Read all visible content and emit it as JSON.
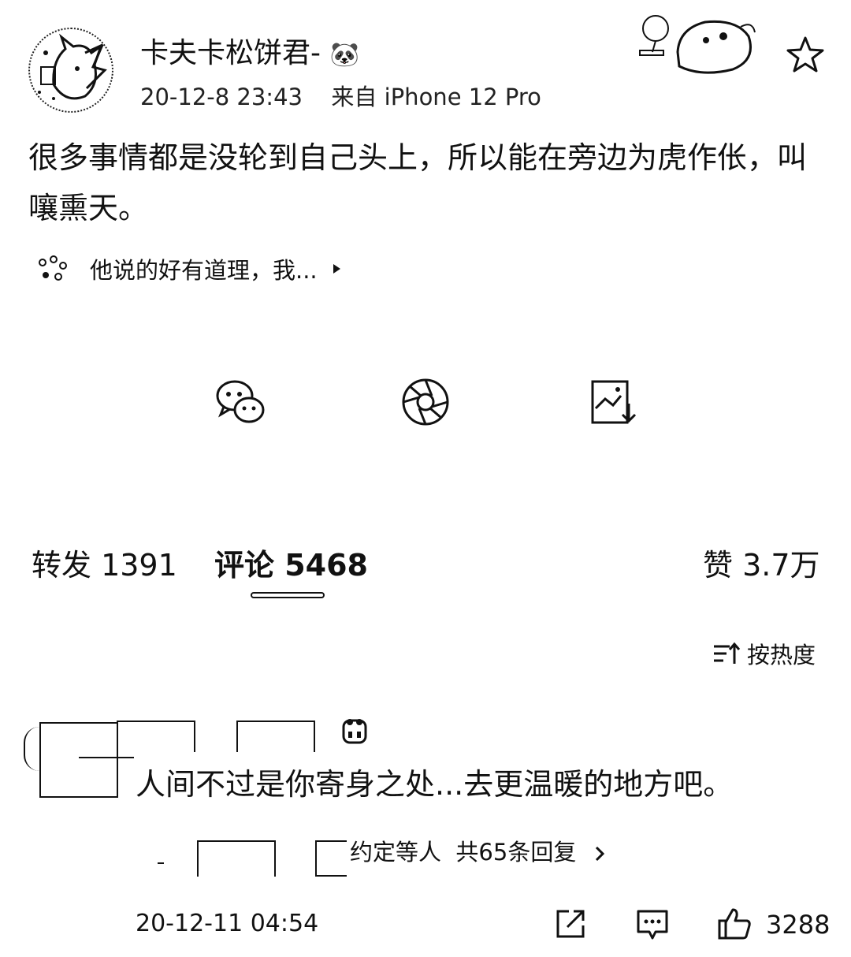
{
  "post": {
    "username": "卡夫卡松饼君-",
    "username_emoji": "🐼",
    "timestamp": "20-12-8 23:43",
    "source": "来自 iPhone 12 Pro",
    "content": "很多事情都是没轮到自己头上，所以能在旁边为虎作伥，叫嚷熏天。",
    "topic_text": "他说的好有道理，我...",
    "icons": {
      "favorite": "star-icon",
      "topic": "sparkle-icon",
      "share": [
        "wechat-icon",
        "moments-icon",
        "save-image-icon"
      ]
    }
  },
  "tabs": {
    "repost": "转发 1391",
    "comments": "评论 5468",
    "likes": "赞 3.7万"
  },
  "sort": {
    "label": "按热度"
  },
  "comment": {
    "text": "人间不过是你寄身之处...去更温暖的地方吧。",
    "reply_summary": "约定等人  共65条回复",
    "time": "20-12-11 04:54",
    "like_count": "3288"
  },
  "colors": {
    "background": "#ffffff",
    "text": "#111111"
  }
}
